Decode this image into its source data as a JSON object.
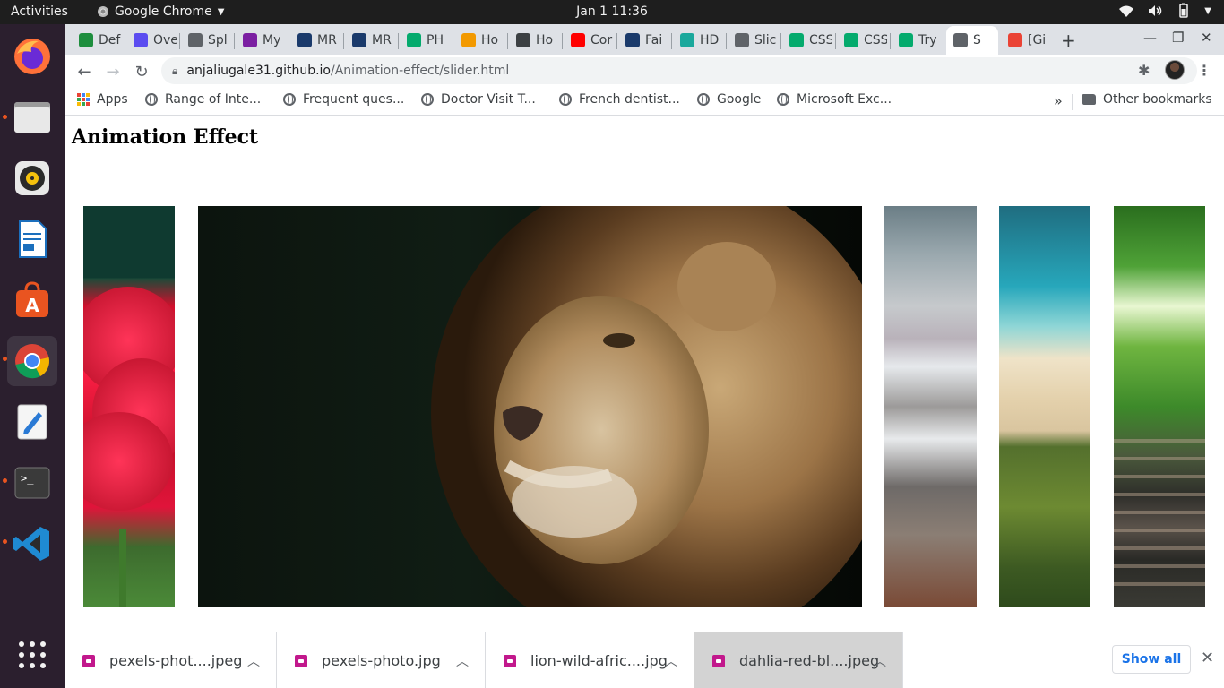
{
  "system": {
    "activities_label": "Activities",
    "app_menu_label": "Google Chrome",
    "clock": "Jan 1  11:36"
  },
  "tabs": [
    {
      "title": "Def",
      "favicon_color": "#1e8e3e"
    },
    {
      "title": "Ove",
      "favicon_color": "#5b4cf0"
    },
    {
      "title": "Spl",
      "favicon_color": "#5f6368"
    },
    {
      "title": "My",
      "favicon_color": "#7b1fa2"
    },
    {
      "title": "MR",
      "favicon_color": "#1a3a6b"
    },
    {
      "title": "MR",
      "favicon_color": "#1a3a6b"
    },
    {
      "title": "PH",
      "favicon_color": "#04aa6d"
    },
    {
      "title": "Ho",
      "favicon_color": "#f29900"
    },
    {
      "title": "Ho",
      "favicon_color": "#3c4043"
    },
    {
      "title": "Cor",
      "favicon_color": "#ff0000"
    },
    {
      "title": "Fai",
      "favicon_color": "#1a3a6b"
    },
    {
      "title": "HD",
      "favicon_color": "#1aa89c"
    },
    {
      "title": "Slic",
      "favicon_color": "#5f6368"
    },
    {
      "title": "CSS",
      "favicon_color": "#04aa6d"
    },
    {
      "title": "CSS",
      "favicon_color": "#04aa6d"
    },
    {
      "title": "Try",
      "favicon_color": "#04aa6d"
    },
    {
      "title": "S",
      "favicon_color": "#5f6368"
    },
    {
      "title": "[Gi",
      "favicon_color": "#ea4335"
    }
  ],
  "omnibox": {
    "host": "anjaliugale31.github.io",
    "path": "/Animation-effect/slider.html"
  },
  "bookmarks": {
    "apps_label": "Apps",
    "items": [
      "Range of Inte...",
      "Frequent ques...",
      "Doctor Visit T...",
      "French dentist...",
      "Google",
      "Microsoft Exc..."
    ],
    "overflow_label": "»",
    "other_label": "Other bookmarks"
  },
  "page": {
    "heading": "Animation Effect",
    "slides": [
      "red dahlia flower",
      "lion",
      "snowy mountain",
      "aerial beach",
      "forest railway"
    ]
  },
  "downloads": {
    "items": [
      "pexels-phot....jpeg",
      "pexels-photo.jpg",
      "lion-wild-afric....jpg",
      "dahlia-red-bl....jpeg"
    ],
    "show_all_label": "Show all"
  }
}
